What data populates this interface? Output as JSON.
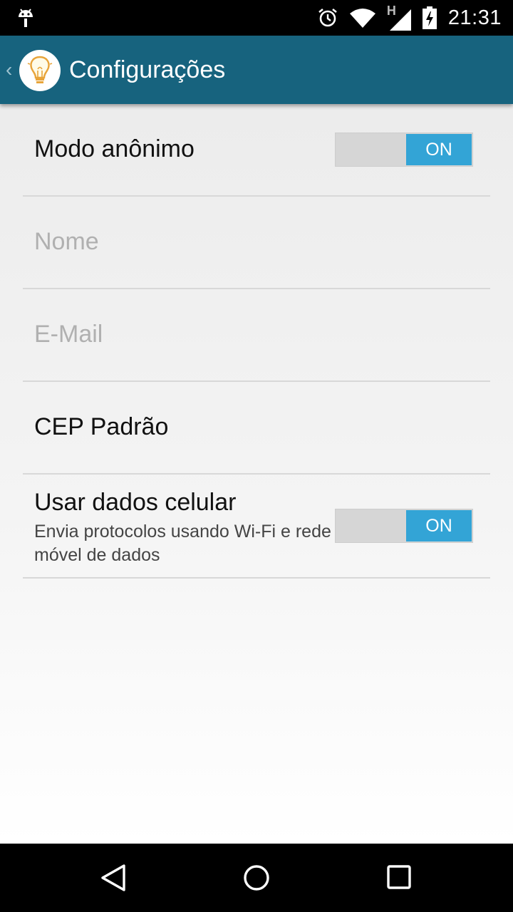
{
  "status_bar": {
    "time": "21:31",
    "icons": [
      "android-debug-icon",
      "alarm-icon",
      "wifi-icon",
      "signal-h-icon",
      "battery-charging-icon"
    ],
    "network_type": "H"
  },
  "action_bar": {
    "title": "Configurações",
    "app_icon": "lightbulb-icon",
    "background_color": "#17637e"
  },
  "preferences": [
    {
      "key": "anonymous_mode",
      "label": "Modo anônimo",
      "type": "switch",
      "state": "ON",
      "enabled": true
    },
    {
      "key": "name",
      "label": "Nome",
      "type": "text",
      "enabled": false
    },
    {
      "key": "email",
      "label": "E-Mail",
      "type": "text",
      "enabled": false
    },
    {
      "key": "default_cep",
      "label": "CEP Padrão",
      "type": "text",
      "enabled": true
    },
    {
      "key": "use_mobile_data",
      "label": "Usar dados celular",
      "summary": "Envia protocolos usando Wi-Fi e rede móvel de dados",
      "type": "switch",
      "state": "ON",
      "enabled": true
    }
  ],
  "switch_on_color": "#33a4d6",
  "nav_bar": {
    "buttons": [
      "back-icon",
      "home-icon",
      "recents-icon"
    ]
  }
}
